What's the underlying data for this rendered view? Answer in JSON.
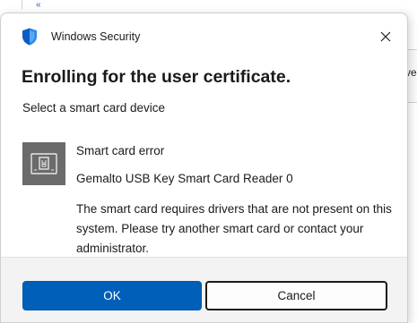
{
  "background": {
    "glyph": "«",
    "partial_text": "ve"
  },
  "dialog": {
    "app_title": "Windows Security",
    "heading": "Enrolling for the user certificate.",
    "subtitle": "Select a smart card device",
    "device": {
      "icon": "smart-card-reader-icon",
      "error_title": "Smart card error",
      "name": "Gemalto USB Key Smart Card Reader 0",
      "message": "The smart card requires drivers that are not present on this system. Please try another smart card or contact your administrator."
    },
    "buttons": {
      "ok": "OK",
      "cancel": "Cancel"
    },
    "colors": {
      "primary_button": "#005fb8",
      "shield_blue": "#0a5cc2",
      "device_tile": "#6b6b6b"
    }
  }
}
